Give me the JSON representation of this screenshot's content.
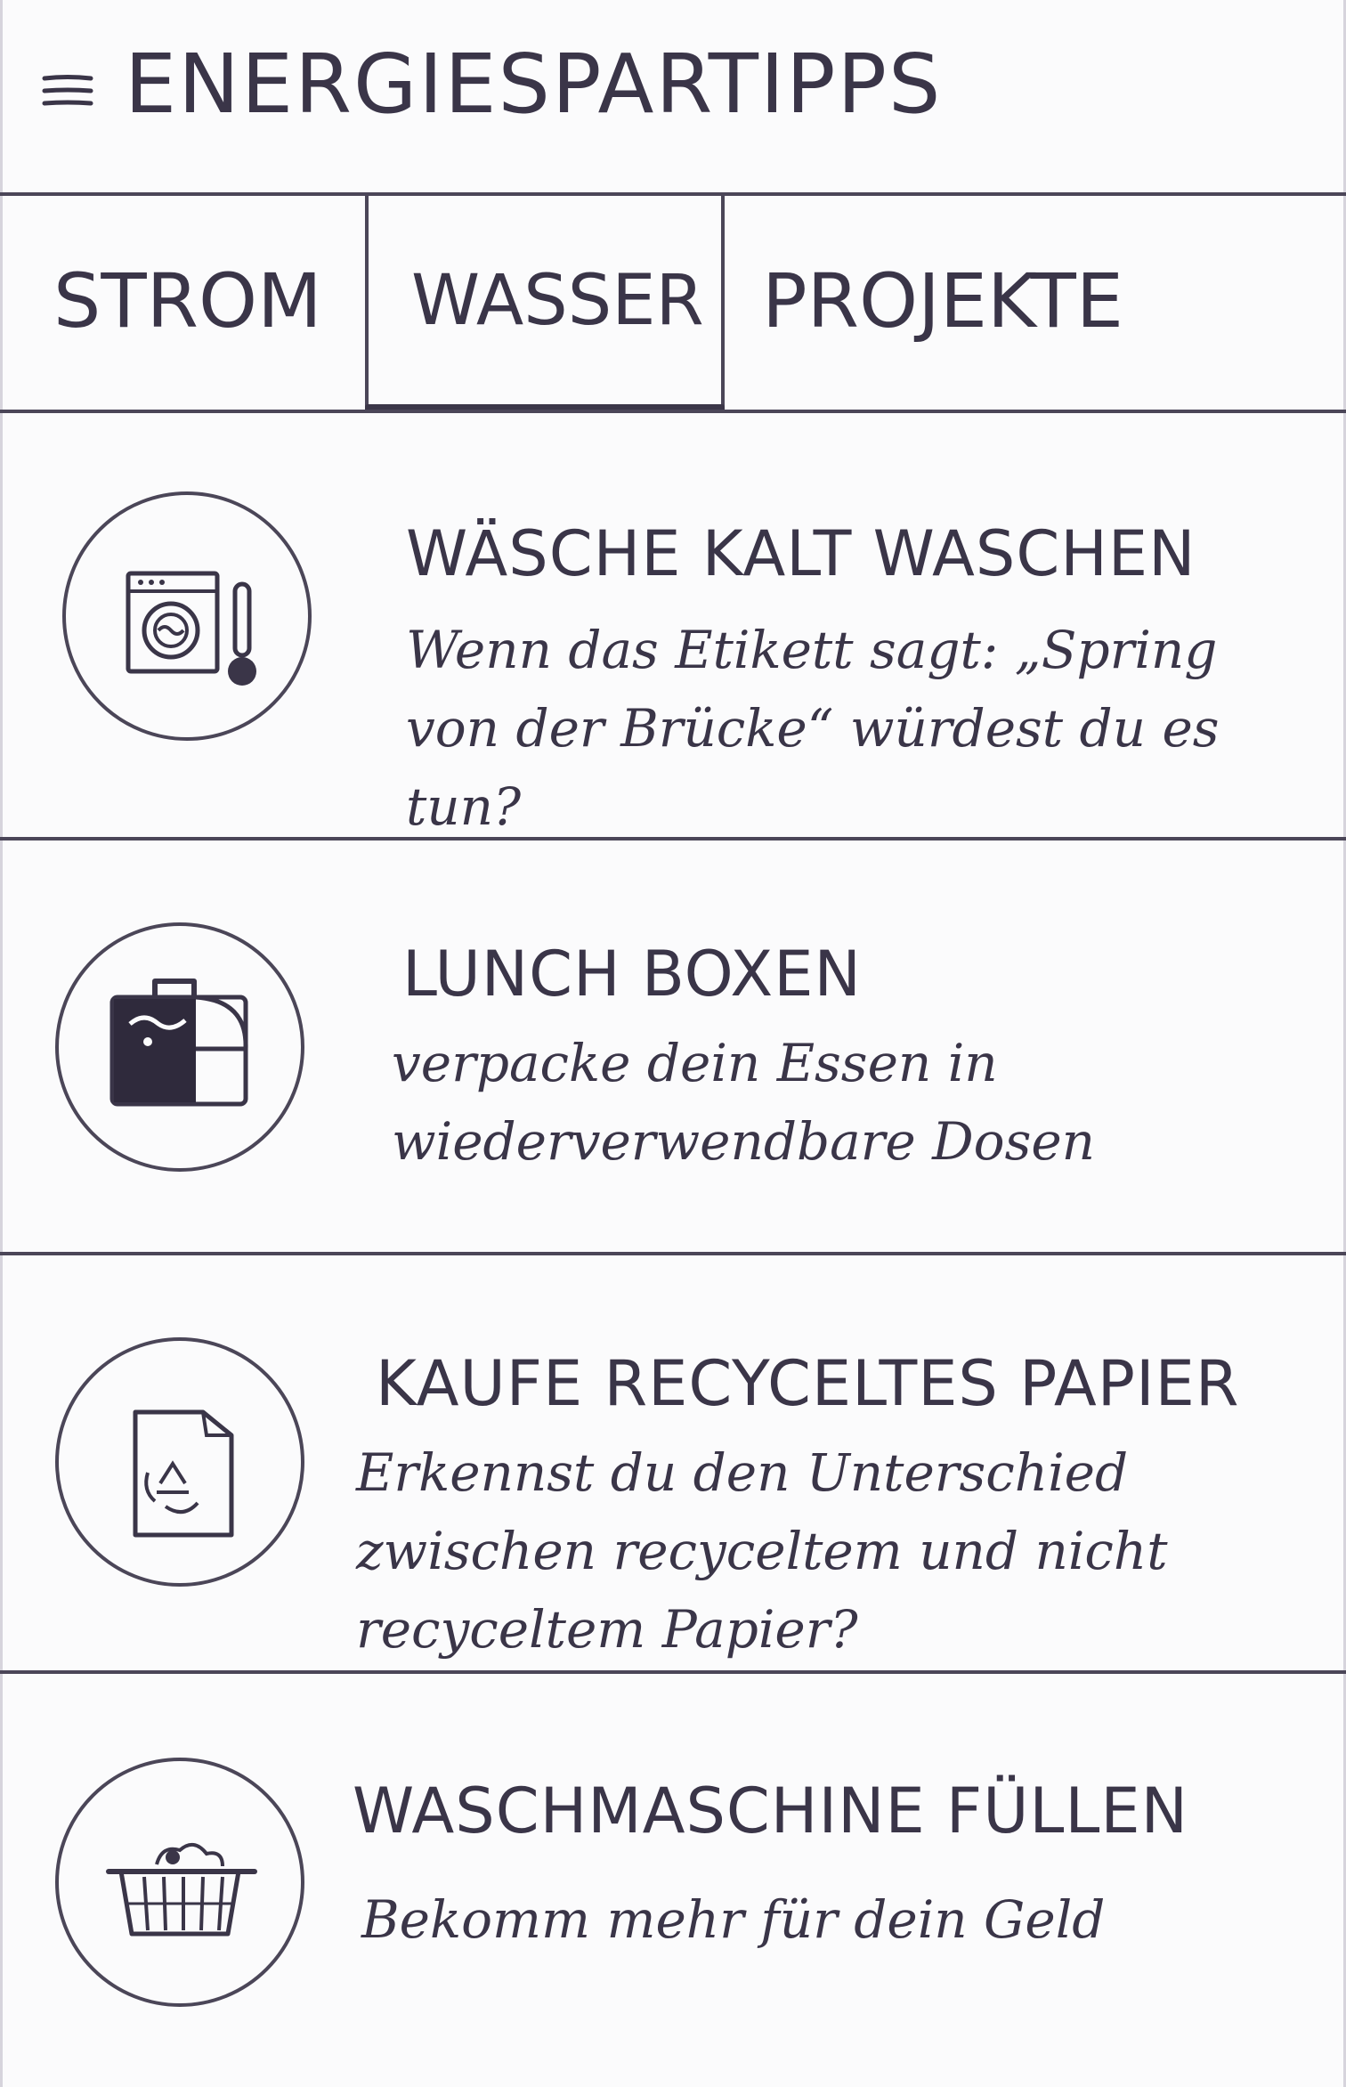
{
  "header": {
    "title": "ENERGIESPARTIPPS",
    "menu_icon": "hamburger-menu-icon"
  },
  "tabs": [
    {
      "label": "STROM",
      "selected": false
    },
    {
      "label": "WASSER",
      "selected": true
    },
    {
      "label": "PROJEKTE",
      "selected": false
    }
  ],
  "tips": [
    {
      "icon": "washing-machine-thermometer-icon",
      "title": "WÄSCHE KALT WASCHEN",
      "description": "Wenn das Etikett sagt: „Spring von der Brücke“ würdest du es tun?"
    },
    {
      "icon": "lunch-box-icon",
      "title": "LUNCH BOXEN",
      "description": "verpacke dein Essen in wiederverwendbare Dosen"
    },
    {
      "icon": "recycled-paper-icon",
      "title": "KAUFE RECYCELTES PAPIER",
      "description": "Erkennst du den Unterschied zwischen recyceltem und nicht recyceltem Papier?"
    },
    {
      "icon": "laundry-basket-icon",
      "title": "WASCHMASCHINE FÜLLEN",
      "description": "Bekomm mehr für dein Geld"
    }
  ],
  "colors": {
    "ink": "#3a3548",
    "paper": "#fbfbfc"
  }
}
